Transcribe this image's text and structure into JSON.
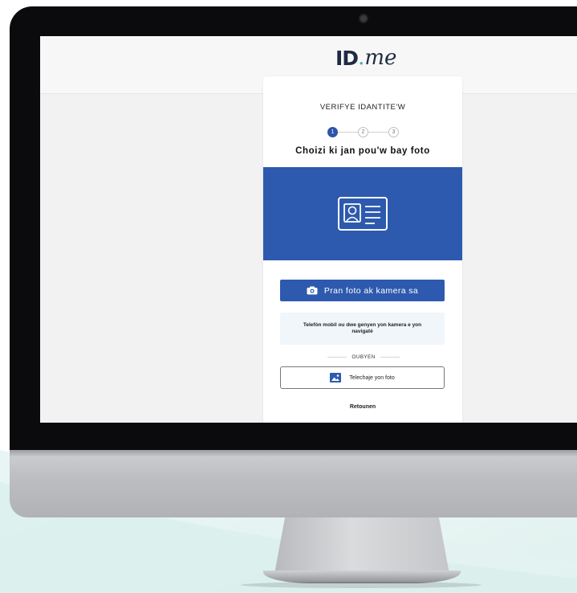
{
  "logo": {
    "id_text": "ID",
    "dot_text": ".",
    "me_text": "me"
  },
  "card": {
    "title": "VERIFYE IDANTITE'W",
    "steps": [
      "1",
      "2",
      "3"
    ],
    "subtitle": "Choizi ki jan pou'w bay foto"
  },
  "primary_button": {
    "label": "Pran foto ak kamera sa"
  },
  "info_box": {
    "text": "Telefòn mobil ou dwe genyen yon kamera e yon navigatè"
  },
  "divider": {
    "label": "OUBYEN"
  },
  "secondary_button": {
    "label": "Telechaje yon foto"
  },
  "back_link": {
    "label": "Retounen"
  },
  "colors": {
    "brand_blue": "#2d5aae",
    "logo_navy": "#1f2a44",
    "logo_accent": "#2fb4a6"
  },
  "icons": {
    "hero": "id-card-icon",
    "primary_button": "camera-icon",
    "secondary_button": "image-upload-icon"
  }
}
